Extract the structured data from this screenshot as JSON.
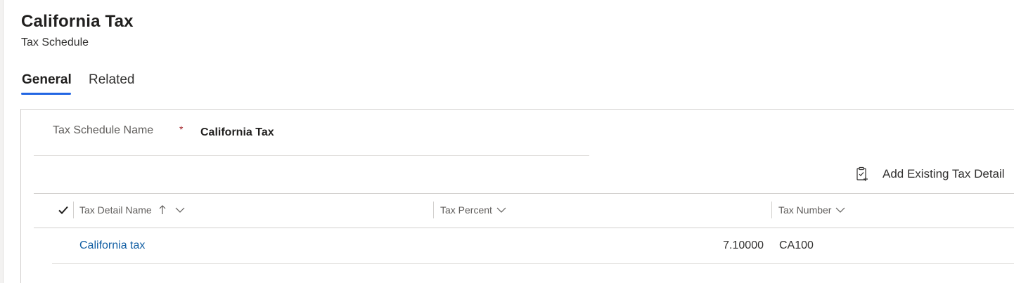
{
  "header": {
    "title": "California Tax",
    "subtitle": "Tax Schedule"
  },
  "tabs": [
    {
      "label": "General",
      "selected": true
    },
    {
      "label": "Related",
      "selected": false
    }
  ],
  "form": {
    "tax_schedule_name_label": "Tax Schedule Name",
    "required_marker": "*",
    "tax_schedule_name_value": "California Tax"
  },
  "subgrid": {
    "command_label": "Add Existing Tax Detail",
    "columns": [
      {
        "label": "Tax Detail Name",
        "sort": "ascending"
      },
      {
        "label": "Tax Percent"
      },
      {
        "label": "Tax Number"
      }
    ],
    "rows": [
      {
        "name": "California tax",
        "percent": "7.10000",
        "number": "CA100"
      }
    ]
  },
  "colors": {
    "accent": "#2266e3",
    "link": "#115ea3",
    "required": "#a4262c"
  }
}
